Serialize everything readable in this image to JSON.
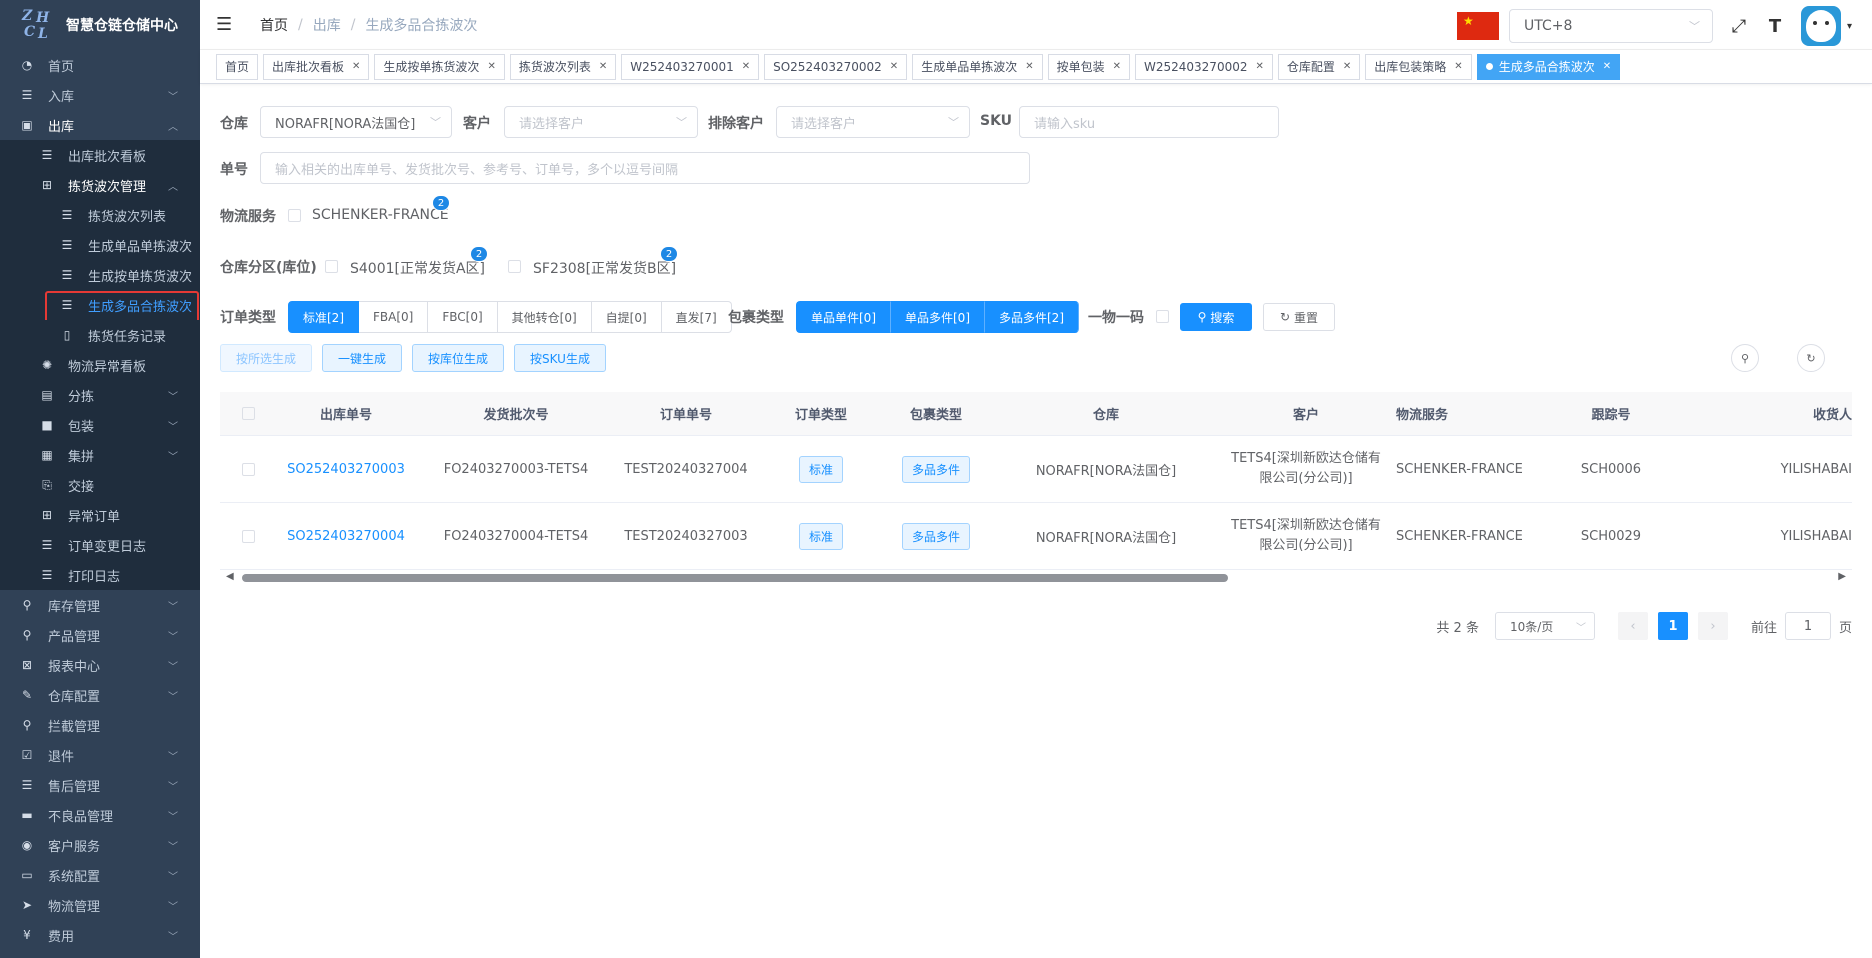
{
  "app": {
    "title": "智慧仓链仓储中心",
    "logo_letters": [
      "Z",
      "H",
      "C",
      "L"
    ]
  },
  "sidebar": {
    "items": [
      {
        "label": "首页",
        "icon": "dashboard-icon"
      },
      {
        "label": "入库",
        "icon": "list-icon"
      },
      {
        "label": "出库",
        "icon": "outbound-icon"
      },
      {
        "label": "出库批次看板",
        "icon": "list-icon"
      },
      {
        "label": "拣货波次管理",
        "icon": "grid-icon"
      },
      {
        "label": "拣货波次列表",
        "icon": "list-icon"
      },
      {
        "label": "生成单品单拣波次",
        "icon": "list-icon"
      },
      {
        "label": "生成按单拣货波次",
        "icon": "list-icon"
      },
      {
        "label": "生成多品合拣波次",
        "icon": "list-icon"
      },
      {
        "label": "拣货任务记录",
        "icon": "book-icon"
      },
      {
        "label": "物流异常看板",
        "icon": "bug-icon"
      },
      {
        "label": "分拣",
        "icon": "doc-icon"
      },
      {
        "label": "包装",
        "icon": "lock-icon"
      },
      {
        "label": "集拼",
        "icon": "box-icon"
      },
      {
        "label": "交接",
        "icon": "handover-icon"
      },
      {
        "label": "异常订单",
        "icon": "grid-icon"
      },
      {
        "label": "订单变更日志",
        "icon": "list-icon"
      },
      {
        "label": "打印日志",
        "icon": "list-icon"
      },
      {
        "label": "库存管理",
        "icon": "stock-icon"
      },
      {
        "label": "产品管理",
        "icon": "product-icon"
      },
      {
        "label": "报表中心",
        "icon": "report-icon"
      },
      {
        "label": "仓库配置",
        "icon": "edit-icon"
      },
      {
        "label": "拦截管理",
        "icon": "intercept-icon"
      },
      {
        "label": "退件",
        "icon": "check-icon"
      },
      {
        "label": "售后管理",
        "icon": "list-icon"
      },
      {
        "label": "不良品管理",
        "icon": "defect-icon"
      },
      {
        "label": "客户服务",
        "icon": "user-icon"
      },
      {
        "label": "系统配置",
        "icon": "system-icon"
      },
      {
        "label": "物流管理",
        "icon": "send-icon"
      },
      {
        "label": "费用",
        "icon": "yen-icon"
      }
    ]
  },
  "header": {
    "breadcrumb": [
      "首页",
      "出库",
      "生成多品合拣波次"
    ],
    "timezone": "UTC+8",
    "flag_star": "★"
  },
  "tags": [
    {
      "label": "首页",
      "closable": false
    },
    {
      "label": "出库批次看板",
      "closable": true
    },
    {
      "label": "生成按单拣货波次",
      "closable": true
    },
    {
      "label": "拣货波次列表",
      "closable": true
    },
    {
      "label": "W252403270001",
      "closable": true
    },
    {
      "label": "SO252403270002",
      "closable": true
    },
    {
      "label": "生成单品单拣波次",
      "closable": true
    },
    {
      "label": "按单包装",
      "closable": true
    },
    {
      "label": "W252403270002",
      "closable": true
    },
    {
      "label": "仓库配置",
      "closable": true
    },
    {
      "label": "出库包装策略",
      "closable": true
    },
    {
      "label": "生成多品合拣波次",
      "closable": true,
      "active": true
    }
  ],
  "filters": {
    "warehouse_label": "仓库",
    "warehouse_value": "NORAFR[NORA法国仓]",
    "customer_label": "客户",
    "customer_placeholder": "请选择客户",
    "exclude_label": "排除客户",
    "exclude_placeholder": "请选择客户",
    "sku_label": "SKU",
    "sku_placeholder": "请输入sku",
    "order_no_label": "单号",
    "order_no_placeholder": "输入相关的出库单号、发货批次号、参考号、订单号，多个以逗号间隔",
    "logistics_label": "物流服务",
    "logistics_option": "SCHENKER-FRANCE",
    "logistics_badge": "2",
    "zone_label": "仓库分区(库位)",
    "zone_options": [
      {
        "label": "S4001[正常发货A区]",
        "badge": "2"
      },
      {
        "label": "SF2308[正常发货B区]",
        "badge": "2"
      }
    ],
    "order_type_label": "订单类型",
    "order_types": [
      "标准[2]",
      "FBA[0]",
      "FBC[0]",
      "其他转仓[0]",
      "自提[0]",
      "直发[7]"
    ],
    "package_type_label": "包裹类型",
    "package_types": [
      "单品单件[0]",
      "单品多件[0]",
      "多品多件[2]"
    ],
    "one_code_label": "一物一码",
    "search_label": "搜索",
    "reset_label": "重置"
  },
  "actions": {
    "selected": "按所选生成",
    "one_click": "一键生成",
    "by_location": "按库位生成",
    "by_sku": "按SKU生成"
  },
  "table": {
    "columns": [
      "出库单号",
      "发货批次号",
      "订单单号",
      "订单类型",
      "包裹类型",
      "仓库",
      "客户",
      "物流服务",
      "跟踪号",
      "收货人"
    ],
    "rows": [
      {
        "outbound_no": "SO252403270003",
        "batch_no": "FO2403270003-TETS4",
        "order_no": "TEST20240327004",
        "order_type": "标准",
        "package_type": "多品多件",
        "warehouse": "NORAFR[NORA法国仓]",
        "customer_line1": "TETS4[深圳新欧达仓储有",
        "customer_line2": "限公司(分公司)]",
        "logistics": "SCHENKER-FRANCE",
        "tracking": "SCH0006",
        "receiver": "YILISHABAI"
      },
      {
        "outbound_no": "SO252403270004",
        "batch_no": "FO2403270004-TETS4",
        "order_no": "TEST20240327003",
        "order_type": "标准",
        "package_type": "多品多件",
        "warehouse": "NORAFR[NORA法国仓]",
        "customer_line1": "TETS4[深圳新欧达仓储有",
        "customer_line2": "限公司(分公司)]",
        "logistics": "SCHENKER-FRANCE",
        "tracking": "SCH0029",
        "receiver": "YILISHABAI"
      }
    ]
  },
  "pagination": {
    "total": "共 2 条",
    "page_size": "10条/页",
    "current": "1",
    "goto_label": "前往",
    "goto_value": "1",
    "page_suffix": "页"
  },
  "colors": {
    "primary": "#1890ff",
    "sidebar_bg": "#304156",
    "highlight": "#e53935"
  }
}
